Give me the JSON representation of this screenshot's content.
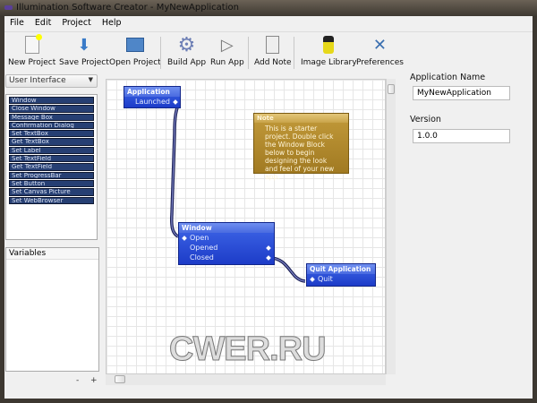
{
  "window": {
    "title": "Illumination Software Creator - MyNewApplication"
  },
  "menu": [
    "File",
    "Edit",
    "Project",
    "Help"
  ],
  "toolbar": [
    {
      "label": "New Project",
      "icon": "new-project-icon"
    },
    {
      "label": "Save Project",
      "icon": "save-project-icon"
    },
    {
      "label": "Open Project",
      "icon": "open-project-icon"
    },
    {
      "label": "Build App",
      "icon": "gear-icon"
    },
    {
      "label": "Run App",
      "icon": "play-icon"
    },
    {
      "label": "Add Note",
      "icon": "note-icon"
    },
    {
      "label": "Image Library",
      "icon": "image-library-icon"
    },
    {
      "label": "Preferences",
      "icon": "tools-icon"
    }
  ],
  "sidebar": {
    "category": "User Interface",
    "blocks": [
      "Window",
      "Close Window",
      "Message Box",
      "Confirmation Dialog",
      "Set TextBox",
      "Get TextBox",
      "Set Label",
      "Set TextField",
      "Get TextField",
      "Set ProgressBar",
      "Set Button",
      "Set Canvas Picture",
      "Set WebBrowser"
    ],
    "variables_header": "Variables",
    "remove_label": "-",
    "add_label": "+"
  },
  "canvas": {
    "application": {
      "title": "Application",
      "outputs": [
        "Launched"
      ]
    },
    "note": {
      "title": "Note",
      "text": "This is a starter project.  Double click the Window Block below to begin designing the look and feel of your new app."
    },
    "window_block": {
      "title": "Window",
      "rows": [
        "Open",
        "Opened",
        "Closed"
      ]
    },
    "quit": {
      "title": "Quit Application",
      "rows": [
        "Quit"
      ]
    },
    "watermark": "CWER.RU"
  },
  "properties": {
    "app_name_label": "Application Name",
    "app_name": "MyNewApplication",
    "version_label": "Version",
    "version": "1.0.0"
  }
}
